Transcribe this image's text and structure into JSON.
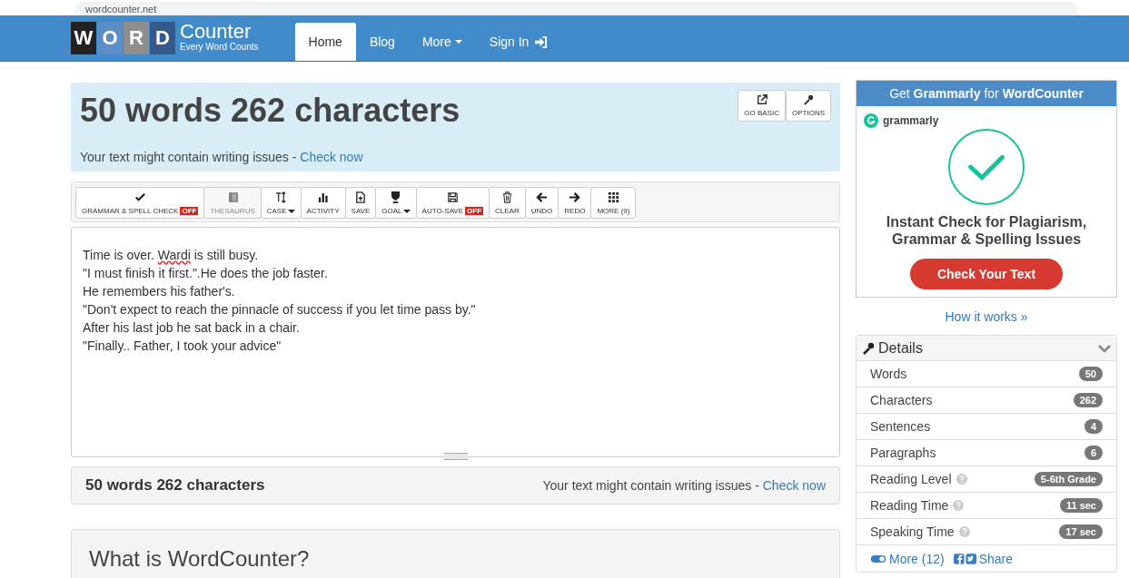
{
  "browser": {
    "url": "wordcounter.net"
  },
  "logo": {
    "letters": [
      "W",
      "O",
      "R",
      "D"
    ],
    "name": "Counter",
    "tagline": "Every Word Counts"
  },
  "nav": [
    {
      "label": "Home",
      "selected": true,
      "dropdown": false
    },
    {
      "label": "Blog",
      "selected": false,
      "dropdown": false
    },
    {
      "label": "More",
      "selected": false,
      "dropdown": true
    },
    {
      "label": "Sign In",
      "selected": false,
      "dropdown": false
    }
  ],
  "hero": {
    "title": "50 words 262 characters",
    "notice": "Your text might contain writing issues - ",
    "notice_link": "Check now",
    "buttons": [
      "GO BASIC",
      "OPTIONS"
    ]
  },
  "toolbar": [
    {
      "label": "GRAMMAR & SPELL CHECK",
      "badge": "OFF",
      "dropdown": false,
      "disabled": false
    },
    {
      "label": "THESAURUS",
      "dropdown": false,
      "disabled": true
    },
    {
      "label": "CASE",
      "dropdown": true,
      "disabled": false
    },
    {
      "label": "ACTIVITY",
      "dropdown": false,
      "disabled": false
    },
    {
      "label": "SAVE",
      "dropdown": false,
      "disabled": false
    },
    {
      "label": "GOAL",
      "dropdown": true,
      "disabled": false
    },
    {
      "label": "AUTO-SAVE",
      "badge": "OFF",
      "dropdown": false,
      "disabled": false
    },
    {
      "label": "CLEAR",
      "dropdown": false,
      "disabled": false
    },
    {
      "label": "UNDO",
      "dropdown": false,
      "disabled": false
    },
    {
      "label": "REDO",
      "dropdown": false,
      "disabled": false
    },
    {
      "label": "MORE (9)",
      "dropdown": false,
      "disabled": false
    }
  ],
  "editor": {
    "lines": [
      [
        {
          "text": "Time is over. ",
          "misspelled": false
        },
        {
          "text": "Wardi",
          "misspelled": true
        },
        {
          "text": " is still busy.",
          "misspelled": false
        }
      ],
      [
        {
          "text": "\"I must finish it first.\".He does the job faster.",
          "misspelled": false
        }
      ],
      [
        {
          "text": "He remembers his father's.",
          "misspelled": false
        }
      ],
      [
        {
          "text": "\"Don't expect to reach the pinnacle of success if you let time pass by.\"",
          "misspelled": false
        }
      ],
      [
        {
          "text": "After his last job he sat back in a chair.",
          "misspelled": false
        }
      ],
      [
        {
          "text": "\"Finally.. Father, I took your advice\"",
          "misspelled": false
        }
      ]
    ]
  },
  "stats_bar": {
    "summary": "50 words 262 characters",
    "notice": "Your text might contain writing issues - ",
    "notice_link": "Check now"
  },
  "section": {
    "title": "What is WordCounter?"
  },
  "ad": {
    "header_prefix": "Get ",
    "header_brand": "Grammarly",
    "header_mid": " for ",
    "header_site": "WordCounter",
    "brand": "grammarly",
    "headline": "Instant Check for Plagiarism, Grammar & Spelling Issues",
    "button": "Check Your Text"
  },
  "how_it_works": "How it works »",
  "details": {
    "title": "Details",
    "expanded": true,
    "rows": [
      {
        "label": "Words",
        "value": "50",
        "help": false
      },
      {
        "label": "Characters",
        "value": "262",
        "help": false
      },
      {
        "label": "Sentences",
        "value": "4",
        "help": false
      },
      {
        "label": "Paragraphs",
        "value": "6",
        "help": false
      },
      {
        "label": "Reading Level",
        "value": "5-6th Grade",
        "help": true
      },
      {
        "label": "Reading Time",
        "value": "11 sec",
        "help": true
      },
      {
        "label": "Speaking Time",
        "value": "17 sec",
        "help": true
      }
    ],
    "more": "More (12)",
    "share": "Share"
  }
}
